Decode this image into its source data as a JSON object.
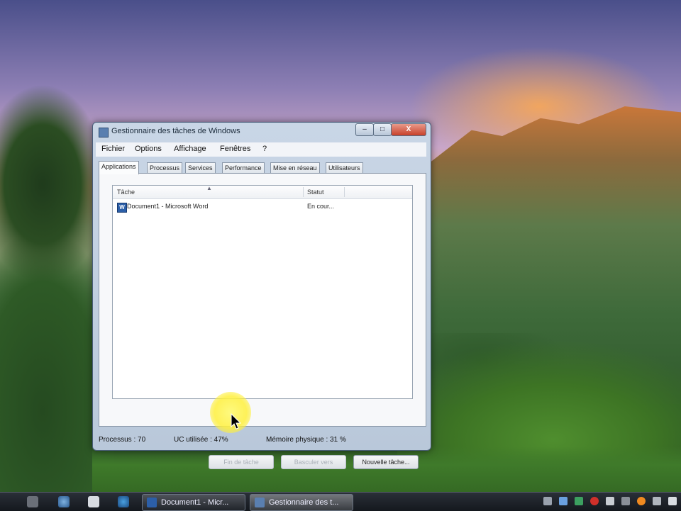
{
  "window": {
    "title": "Gestionnaire des tâches de Windows",
    "controls": {
      "minimize": "–",
      "maximize": "□",
      "close": "X"
    }
  },
  "menu": [
    "Fichier",
    "Options",
    "Affichage",
    "Fenêtres",
    "?"
  ],
  "tabs": [
    "Applications",
    "Processus",
    "Services",
    "Performance",
    "Mise en réseau",
    "Utilisateurs"
  ],
  "list": {
    "columns": {
      "task": "Tâche",
      "status": "Statut"
    },
    "rows": [
      {
        "name": "Document1 - Microsoft Word",
        "status": "En cour..."
      }
    ]
  },
  "buttons": {
    "end_task": "Fin de tâche",
    "switch_to": "Basculer vers",
    "new_task": "Nouvelle tâche..."
  },
  "status": {
    "processes": "Processus : 70",
    "cpu": "UC utilisée : 47%",
    "memory": "Mémoire physique : 31 %"
  },
  "taskbar": {
    "tasks": [
      {
        "label": "Document1 - Micr...",
        "icon": "word-icon"
      },
      {
        "label": "Gestionnaire des t...",
        "icon": "task-manager-icon"
      }
    ]
  },
  "colors": {
    "close_button": "#c8402a",
    "cursor_highlight": "#fff04a",
    "taskbar": "#14181e"
  }
}
